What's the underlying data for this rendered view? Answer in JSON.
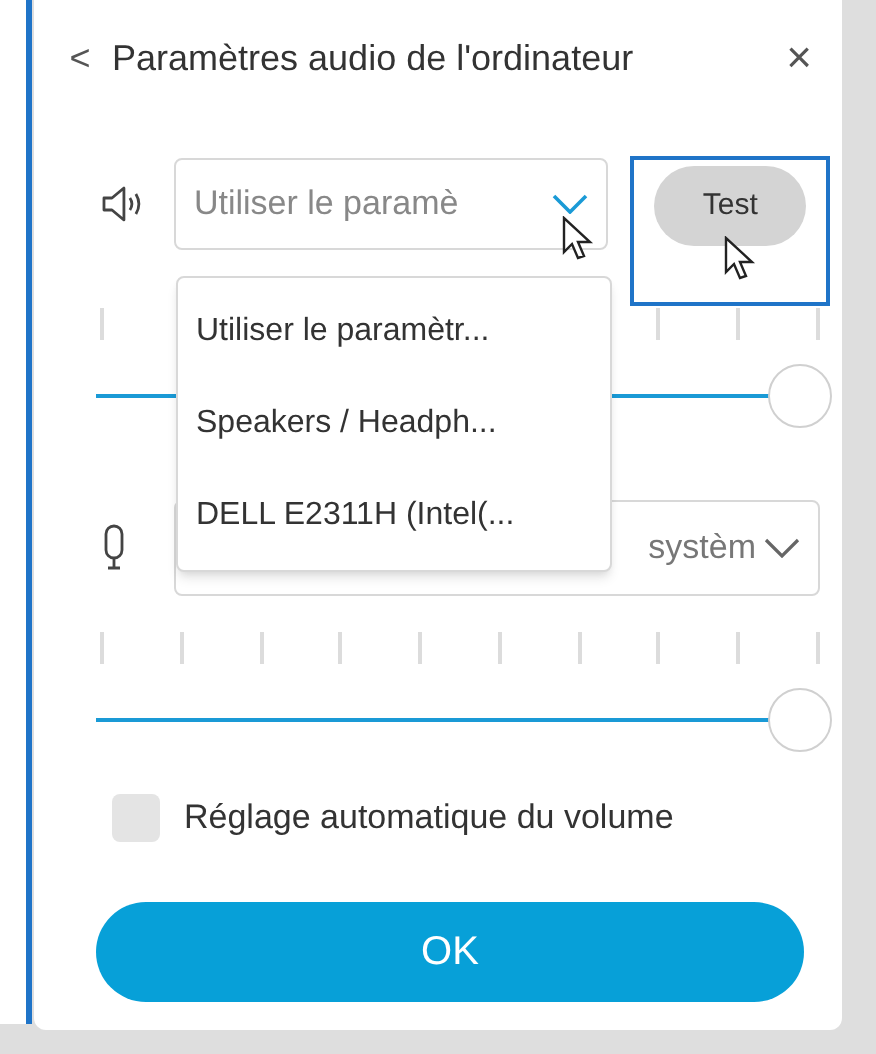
{
  "dialog": {
    "back": "<",
    "title": "Paramètres audio de l'ordinateur",
    "close": "×"
  },
  "speaker": {
    "select_value": "Utiliser le paramè",
    "expanded": true,
    "level": 1,
    "options": [
      {
        "label": "Utiliser le paramètr..."
      },
      {
        "label": "Speakers / Headph..."
      },
      {
        "label": "DELL E2311H (Intel(..."
      }
    ]
  },
  "test_button": {
    "label": "Test",
    "focused": true
  },
  "microphone": {
    "select_value": "systèm",
    "level": 1
  },
  "auto_volume": {
    "label": "Réglage automatique du volume",
    "checked": false
  },
  "ok_button": {
    "label": "OK"
  }
}
